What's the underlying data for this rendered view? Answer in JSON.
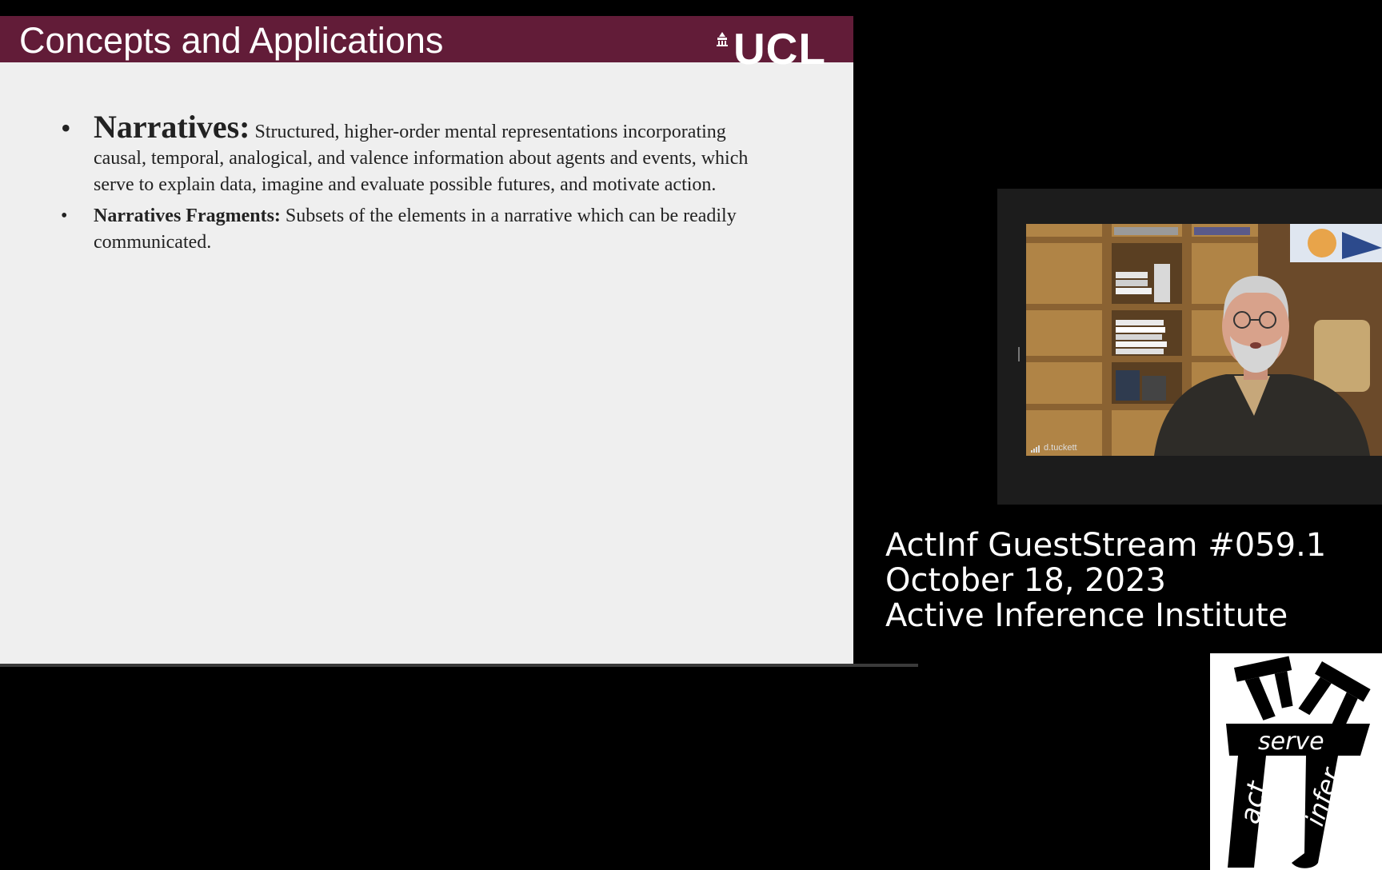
{
  "slide": {
    "title": "Concepts and Applications",
    "logo_text": "UCL",
    "bullets": [
      {
        "term": "Narratives:",
        "text": " Structured, higher-order mental representations incorporating causal, temporal, analogical, and valence information about agents and events, which serve to explain data, imagine and evaluate possible futures, and motivate action."
      },
      {
        "term": "Narratives Fragments:",
        "text": " Subsets of the elements in a narrative which can be readily communicated."
      }
    ]
  },
  "video": {
    "participant_name": "d.tuckett"
  },
  "stream": {
    "line1": "ActInf GuestStream #059.1",
    "line2": "October 18, 2023",
    "line3": "Active Inference Institute"
  },
  "logo": {
    "word_serve": "serve",
    "word_act": "act",
    "word_infer": "infer"
  },
  "colors": {
    "slide_header": "#621c38",
    "slide_bg": "#efefef",
    "page_bg": "#000000"
  }
}
